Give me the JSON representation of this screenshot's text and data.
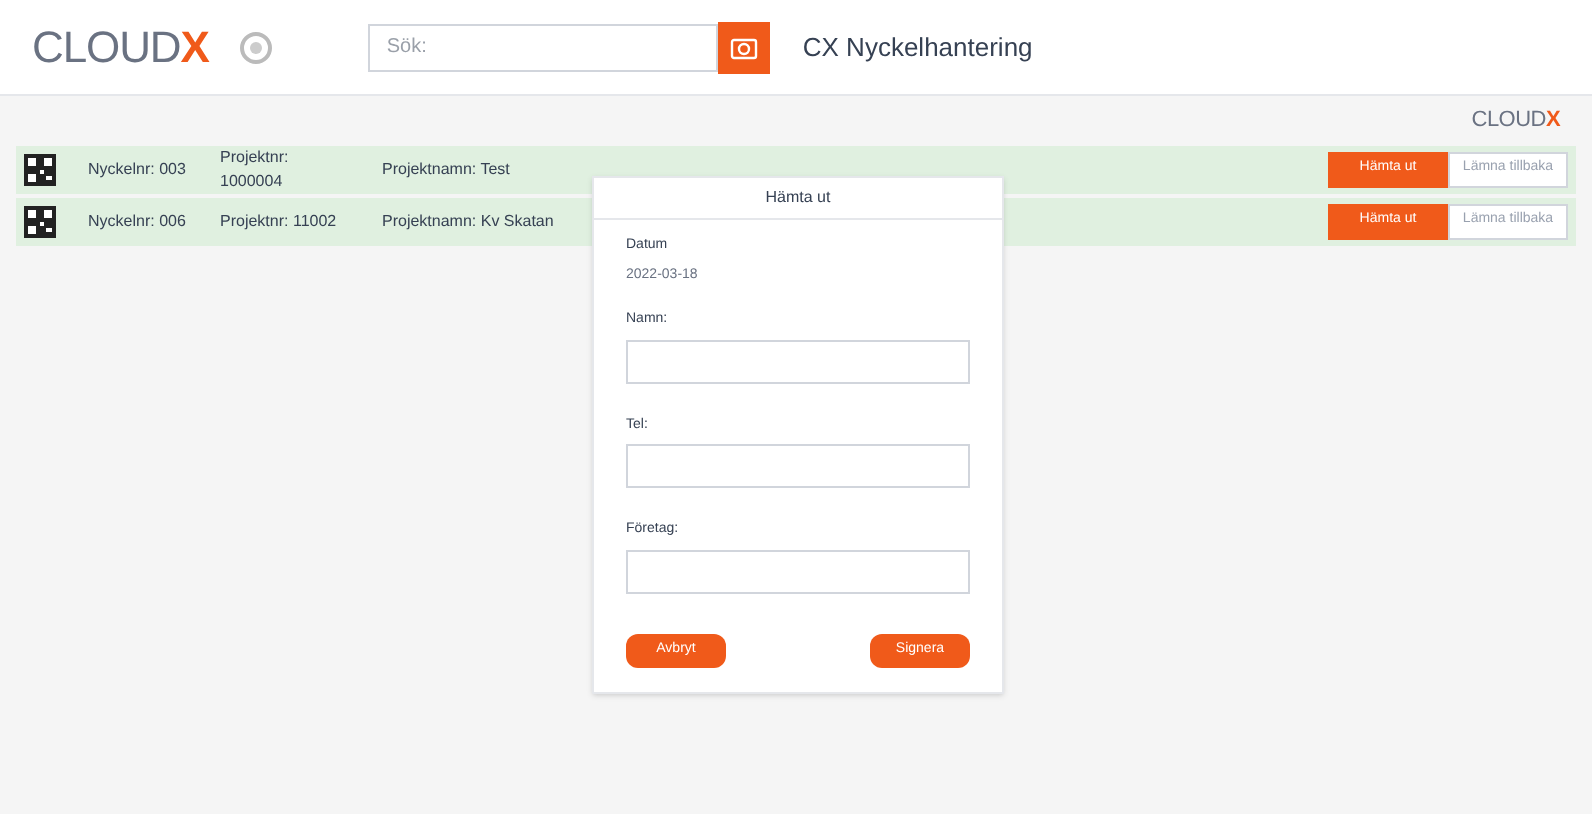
{
  "header": {
    "logo": {
      "word": "CLOUD",
      "mark": "X"
    },
    "search": {
      "placeholder": "Sök:"
    },
    "title": "CX Nyckelhantering"
  },
  "footer_logo": {
    "word": "CLOUD",
    "mark": "X"
  },
  "rows": [
    {
      "key": "Nyckelnr: 003",
      "project_no": "Projektnr: 1000004",
      "project_name": "Projektnamn: Test",
      "buttons": [
        "Hämta ut",
        "Lämna tillbaka"
      ]
    },
    {
      "key": "Nyckelnr: 006",
      "project_no": "Projektnr: 11002",
      "project_name": "Projektnamn: Kv Skatan",
      "buttons": [
        "Hämta ut",
        "Lämna tillbaka"
      ]
    }
  ],
  "dialog": {
    "title": "Hämta ut",
    "date_label": "Datum",
    "date": "2022-03-18",
    "fields": [
      {
        "label": "Namn:"
      },
      {
        "label": "Tel:"
      },
      {
        "label": "Företag:"
      }
    ],
    "buttons": [
      "Avbryt",
      "Signera"
    ]
  }
}
